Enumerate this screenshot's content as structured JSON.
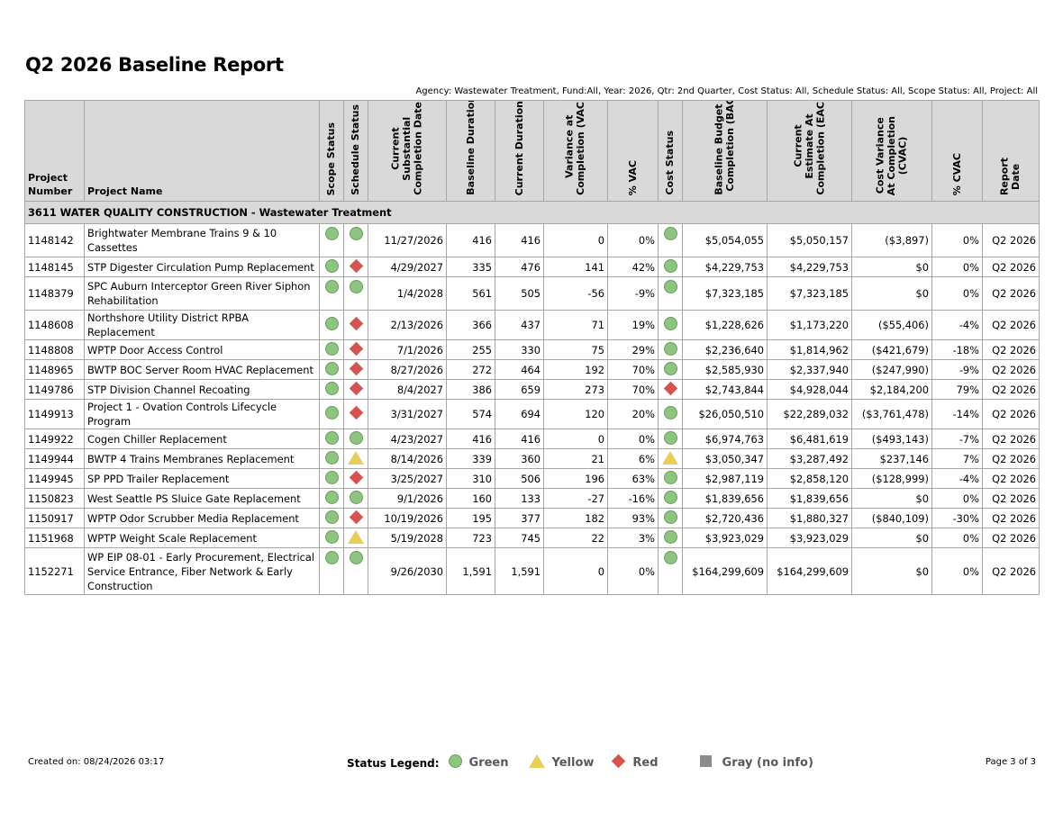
{
  "report": {
    "title": "Q2 2026 Baseline Report",
    "filters": "Agency: Wastewater Treatment, Fund:All, Year: 2026, Qtr: 2nd Quarter, Cost Status: All, Schedule Status: All, Scope Status: All, Project: All"
  },
  "headers": {
    "project_number": "Project\nNumber",
    "project_name": "Project Name",
    "scope_status": "Scope Status",
    "schedule_status": "Schedule Status",
    "completion_date": "Current\nSubstantial\nCompletion Date",
    "baseline_duration": "Baseline Duration",
    "current_duration": "Current Duration",
    "vac": "Variance at\nCompletion (VAC)",
    "pct_vac": "% VAC",
    "cost_status": "Cost Status",
    "bac": "Baseline Budget at\nCompletion (BAC)",
    "eac": "Current\nEstimate At\nCompletion (EAC)",
    "cvac": "Cost Variance\nAt Completion\n(CVAC)",
    "pct_cvac": "% CVAC",
    "report_date": "Report\nDate"
  },
  "group": {
    "label": "3611 WATER QUALITY CONSTRUCTION - Wastewater Treatment"
  },
  "rows": [
    {
      "number": "1148142",
      "name": "Brightwater Membrane Trains 9 & 10 Cassettes",
      "scope": "green",
      "schedule": "green",
      "date": "11/27/2026",
      "baseline": "416",
      "current": "416",
      "vac": "0",
      "pct_vac": "0%",
      "cost": "green",
      "bac": "$5,054,055",
      "eac": "$5,050,157",
      "cvac": "($3,897)",
      "pct_cvac": "0%",
      "report": "Q2 2026",
      "tall": true
    },
    {
      "number": "1148145",
      "name": "STP Digester Circulation Pump Replacement",
      "scope": "green",
      "schedule": "red",
      "date": "4/29/2027",
      "baseline": "335",
      "current": "476",
      "vac": "141",
      "pct_vac": "42%",
      "cost": "green",
      "bac": "$4,229,753",
      "eac": "$4,229,753",
      "cvac": "$0",
      "pct_cvac": "0%",
      "report": "Q2 2026"
    },
    {
      "number": "1148379",
      "name": "SPC Auburn Interceptor Green River Siphon Rehabilitation",
      "scope": "green",
      "schedule": "green",
      "date": "1/4/2028",
      "baseline": "561",
      "current": "505",
      "vac": "-56",
      "pct_vac": "-9%",
      "cost": "green",
      "bac": "$7,323,185",
      "eac": "$7,323,185",
      "cvac": "$0",
      "pct_cvac": "0%",
      "report": "Q2 2026",
      "tall": true
    },
    {
      "number": "1148608",
      "name": "Northshore Utility District RPBA Replacement",
      "scope": "green",
      "schedule": "red",
      "date": "2/13/2026",
      "baseline": "366",
      "current": "437",
      "vac": "71",
      "pct_vac": "19%",
      "cost": "green",
      "bac": "$1,228,626",
      "eac": "$1,173,220",
      "cvac": "($55,406)",
      "pct_cvac": "-4%",
      "report": "Q2 2026"
    },
    {
      "number": "1148808",
      "name": "WPTP Door Access Control",
      "scope": "green",
      "schedule": "red",
      "date": "7/1/2026",
      "baseline": "255",
      "current": "330",
      "vac": "75",
      "pct_vac": "29%",
      "cost": "green",
      "bac": "$2,236,640",
      "eac": "$1,814,962",
      "cvac": "($421,679)",
      "pct_cvac": "-18%",
      "report": "Q2 2026"
    },
    {
      "number": "1148965",
      "name": "BWTP BOC Server Room HVAC Replacement",
      "scope": "green",
      "schedule": "red",
      "date": "8/27/2026",
      "baseline": "272",
      "current": "464",
      "vac": "192",
      "pct_vac": "70%",
      "cost": "green",
      "bac": "$2,585,930",
      "eac": "$2,337,940",
      "cvac": "($247,990)",
      "pct_cvac": "-9%",
      "report": "Q2 2026"
    },
    {
      "number": "1149786",
      "name": "STP Division Channel Recoating",
      "scope": "green",
      "schedule": "red",
      "date": "8/4/2027",
      "baseline": "386",
      "current": "659",
      "vac": "273",
      "pct_vac": "70%",
      "cost": "red",
      "bac": "$2,743,844",
      "eac": "$4,928,044",
      "cvac": "$2,184,200",
      "pct_cvac": "79%",
      "report": "Q2 2026"
    },
    {
      "number": "1149913",
      "name": "Project 1 - Ovation Controls Lifecycle Program",
      "scope": "green",
      "schedule": "red",
      "date": "3/31/2027",
      "baseline": "574",
      "current": "694",
      "vac": "120",
      "pct_vac": "20%",
      "cost": "green",
      "bac": "$26,050,510",
      "eac": "$22,289,032",
      "cvac": "($3,761,478)",
      "pct_cvac": "-14%",
      "report": "Q2 2026"
    },
    {
      "number": "1149922",
      "name": "Cogen Chiller Replacement",
      "scope": "green",
      "schedule": "green",
      "date": "4/23/2027",
      "baseline": "416",
      "current": "416",
      "vac": "0",
      "pct_vac": "0%",
      "cost": "green",
      "bac": "$6,974,763",
      "eac": "$6,481,619",
      "cvac": "($493,143)",
      "pct_cvac": "-7%",
      "report": "Q2 2026"
    },
    {
      "number": "1149944",
      "name": "BWTP 4 Trains Membranes Replacement",
      "scope": "green",
      "schedule": "yellow",
      "date": "8/14/2026",
      "baseline": "339",
      "current": "360",
      "vac": "21",
      "pct_vac": "6%",
      "cost": "yellow",
      "bac": "$3,050,347",
      "eac": "$3,287,492",
      "cvac": "$237,146",
      "pct_cvac": "7%",
      "report": "Q2 2026"
    },
    {
      "number": "1149945",
      "name": "SP PPD Trailer Replacement",
      "scope": "green",
      "schedule": "red",
      "date": "3/25/2027",
      "baseline": "310",
      "current": "506",
      "vac": "196",
      "pct_vac": "63%",
      "cost": "green",
      "bac": "$2,987,119",
      "eac": "$2,858,120",
      "cvac": "($128,999)",
      "pct_cvac": "-4%",
      "report": "Q2 2026"
    },
    {
      "number": "1150823",
      "name": "West Seattle PS Sluice Gate Replacement",
      "scope": "green",
      "schedule": "green",
      "date": "9/1/2026",
      "baseline": "160",
      "current": "133",
      "vac": "-27",
      "pct_vac": "-16%",
      "cost": "green",
      "bac": "$1,839,656",
      "eac": "$1,839,656",
      "cvac": "$0",
      "pct_cvac": "0%",
      "report": "Q2 2026"
    },
    {
      "number": "1150917",
      "name": "WPTP Odor Scrubber Media Replacement",
      "scope": "green",
      "schedule": "red",
      "date": "10/19/2026",
      "baseline": "195",
      "current": "377",
      "vac": "182",
      "pct_vac": "93%",
      "cost": "green",
      "bac": "$2,720,436",
      "eac": "$1,880,327",
      "cvac": "($840,109)",
      "pct_cvac": "-30%",
      "report": "Q2 2026"
    },
    {
      "number": "1151968",
      "name": "WPTP Weight Scale Replacement",
      "scope": "green",
      "schedule": "yellow",
      "date": "5/19/2028",
      "baseline": "723",
      "current": "745",
      "vac": "22",
      "pct_vac": "3%",
      "cost": "green",
      "bac": "$3,923,029",
      "eac": "$3,923,029",
      "cvac": "$0",
      "pct_cvac": "0%",
      "report": "Q2 2026"
    },
    {
      "number": "1152271",
      "name": "WP EIP 08-01 - Early Procurement, Electrical Service Entrance, Fiber Network & Early Construction",
      "scope": "green",
      "schedule": "green",
      "date": "9/26/2030",
      "baseline": "1,591",
      "current": "1,591",
      "vac": "0",
      "pct_vac": "0%",
      "cost": "green",
      "bac": "$164,299,609",
      "eac": "$164,299,609",
      "cvac": "$0",
      "pct_cvac": "0%",
      "report": "Q2 2026",
      "tall": true,
      "lines": 3
    }
  ],
  "footer": {
    "created": "Created on: 08/24/2026 03:17",
    "page": "Page 3 of 3",
    "legend_label": "Status Legend:",
    "legend": [
      {
        "key": "green",
        "label": "Green",
        "icon": "circle-icon"
      },
      {
        "key": "yellow",
        "label": "Yellow",
        "icon": "triangle-icon"
      },
      {
        "key": "red",
        "label": "Red",
        "icon": "diamond-icon"
      },
      {
        "key": "gray",
        "label": "Gray (no info)",
        "icon": "square-icon"
      }
    ]
  },
  "colors": {
    "green": "#8dc47f",
    "yellow": "#e6cf5a",
    "red": "#d35451",
    "gray": "#8c8c8c",
    "header_bg": "#d9d9d9"
  }
}
